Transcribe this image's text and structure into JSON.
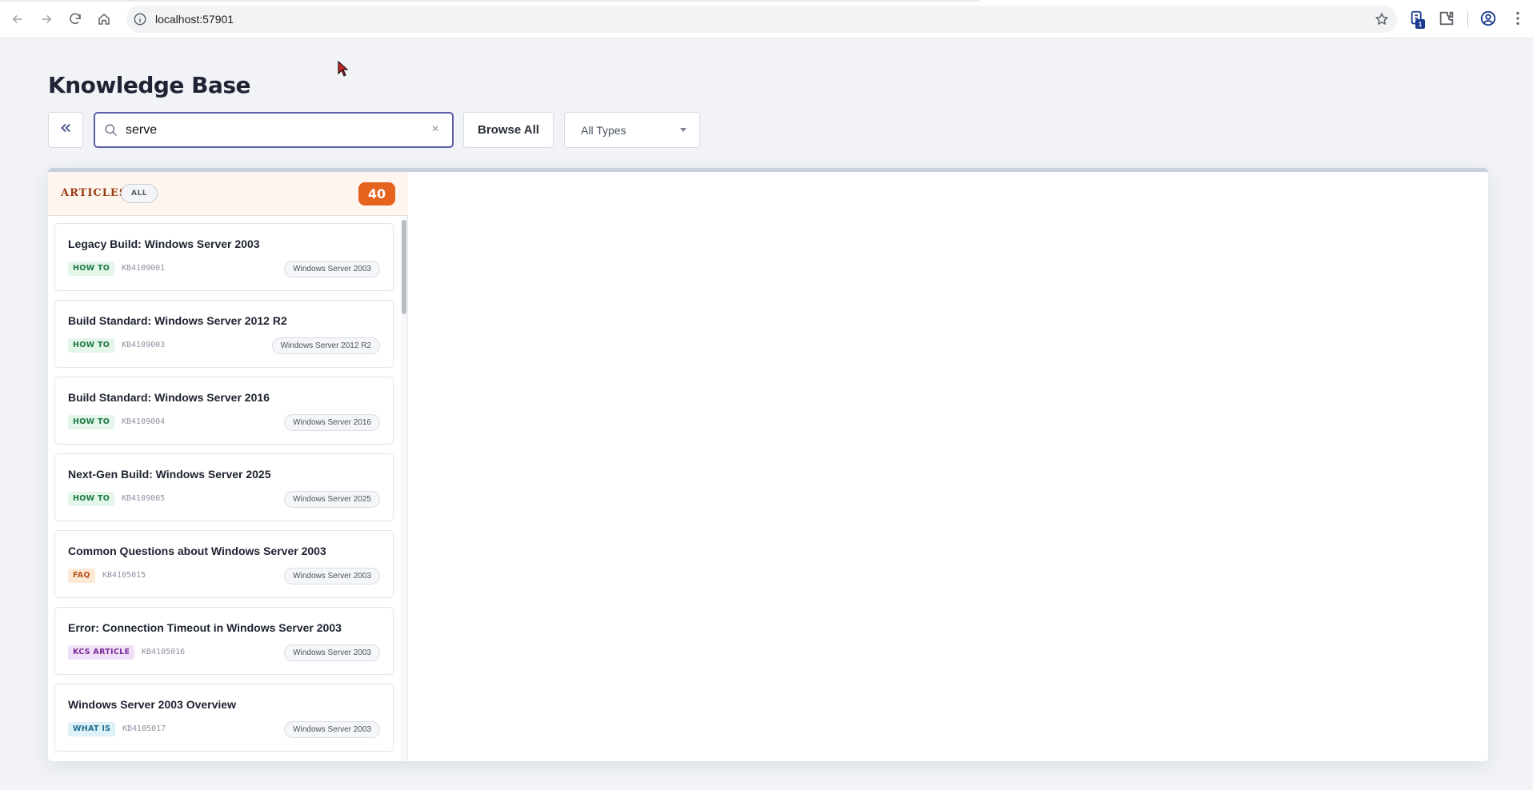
{
  "browser": {
    "url": "localhost:57901",
    "extension_badge": "1",
    "icons": [
      "back-icon",
      "forward-icon",
      "reload-icon",
      "home-icon",
      "info-icon",
      "star-icon",
      "extension-icon",
      "puzzle-icon",
      "profile-icon",
      "menu-icon"
    ]
  },
  "page": {
    "title": "Knowledge Base"
  },
  "toolbar": {
    "search_value": "serve",
    "search_placeholder": "",
    "clear_glyph": "×",
    "browse_label": "Browse All",
    "type_filter_value": "All Types"
  },
  "list": {
    "title": "ARTICLES",
    "filter_pill": "ALL",
    "count": "40",
    "items": [
      {
        "title": "Legacy Build: Windows Server 2003",
        "type": "HOW TO",
        "type_class": "howto",
        "id": "KB4109001",
        "product": "Windows Server 2003"
      },
      {
        "title": "Build Standard: Windows Server 2012 R2",
        "type": "HOW TO",
        "type_class": "howto",
        "id": "KB4109003",
        "product": "Windows Server 2012 R2"
      },
      {
        "title": "Build Standard: Windows Server 2016",
        "type": "HOW TO",
        "type_class": "howto",
        "id": "KB4109004",
        "product": "Windows Server 2016"
      },
      {
        "title": "Next-Gen Build: Windows Server 2025",
        "type": "HOW TO",
        "type_class": "howto",
        "id": "KB4109005",
        "product": "Windows Server 2025"
      },
      {
        "title": "Common Questions about Windows Server 2003",
        "type": "FAQ",
        "type_class": "faq",
        "id": "KB4105015",
        "product": "Windows Server 2003"
      },
      {
        "title": "Error: Connection Timeout in Windows Server 2003",
        "type": "KCS ARTICLE",
        "type_class": "kcs",
        "id": "KB4105016",
        "product": "Windows Server 2003"
      },
      {
        "title": "Windows Server 2003 Overview",
        "type": "WHAT IS",
        "type_class": "whatis",
        "id": "KB4105017",
        "product": "Windows Server 2003"
      }
    ]
  },
  "colors": {
    "accent": "#e2712b",
    "count_badge": "#e5621f",
    "search_border": "#5b5fa8"
  }
}
